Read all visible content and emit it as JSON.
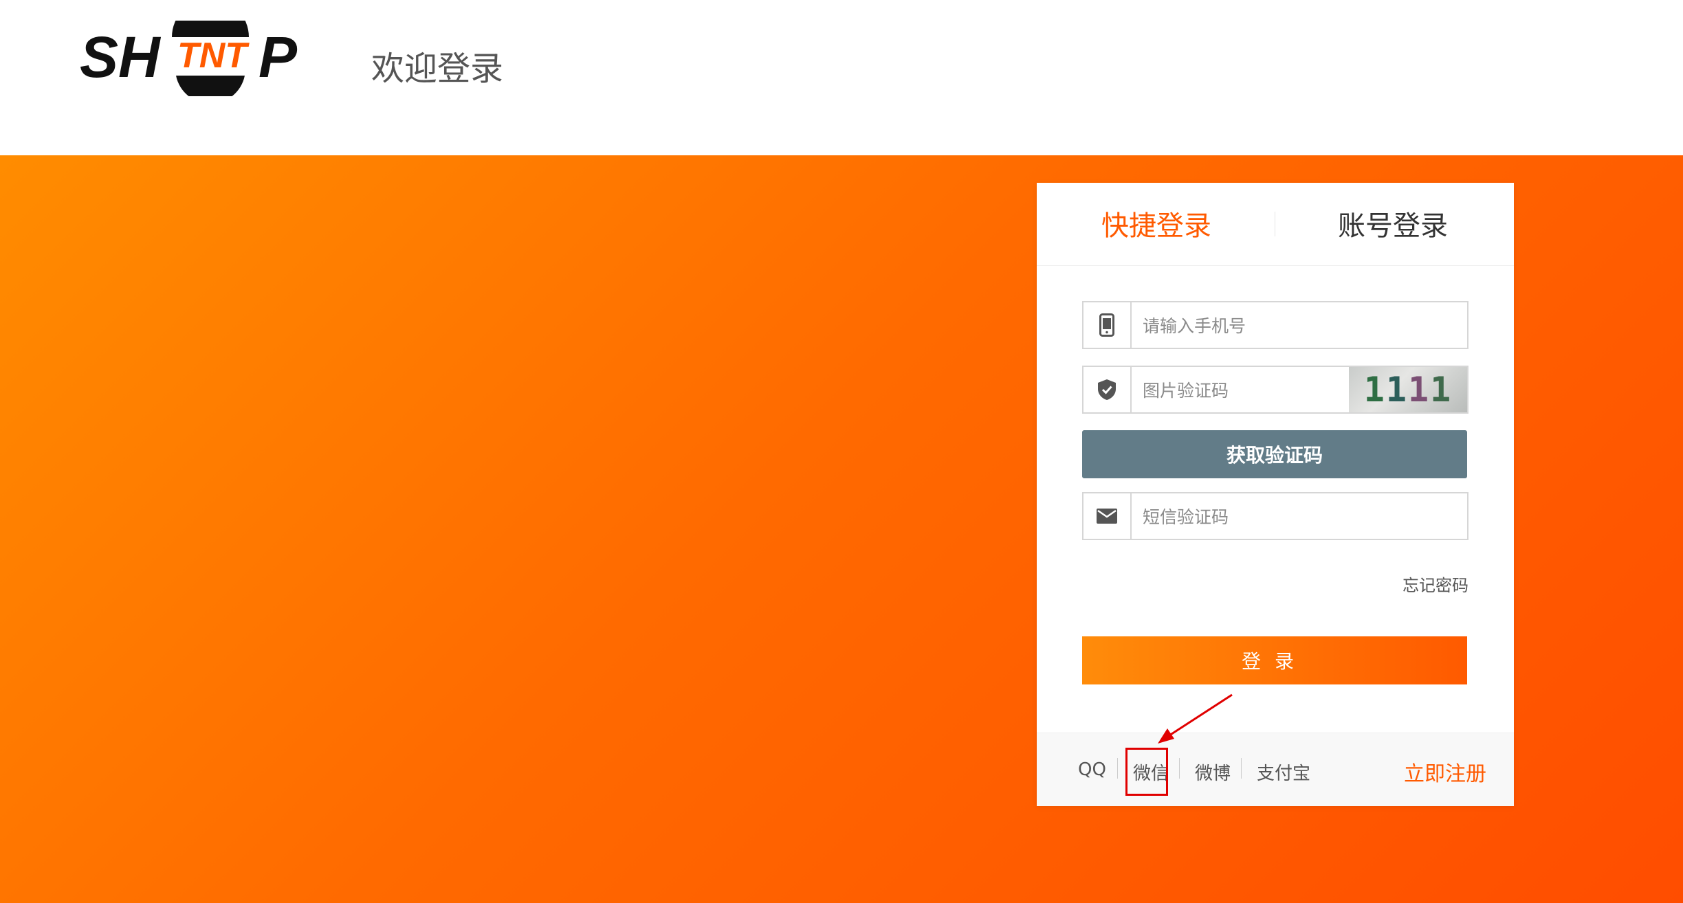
{
  "header": {
    "logo": {
      "left_text": "SH",
      "center_text": "TNT",
      "right_text": "P",
      "colors": {
        "dark": "#111111",
        "accent": "#ff5a00"
      }
    },
    "welcome": "欢迎登录"
  },
  "login_card": {
    "tabs": [
      {
        "label": "快捷登录",
        "active": true
      },
      {
        "label": "账号登录",
        "active": false
      }
    ],
    "phone_field": {
      "icon": "mobile-phone-icon",
      "placeholder": "请输入手机号",
      "value": ""
    },
    "captcha_field": {
      "icon": "shield-check-icon",
      "placeholder": "图片验证码",
      "value": "",
      "captcha_text": "1111"
    },
    "get_code_button": "获取验证码",
    "sms_field": {
      "icon": "envelope-icon",
      "placeholder": "短信验证码",
      "value": ""
    },
    "forgot_password": "忘记密码",
    "login_button": "登录",
    "social_logins": [
      "QQ",
      "微信",
      "微博",
      "支付宝"
    ],
    "register": "立即注册"
  },
  "colors": {
    "accent": "#ff5a00",
    "hero_gradient_start": "#ff8c00",
    "hero_gradient_end": "#ff4d00",
    "get_code_button": "#627c88",
    "annotation": "#e00000"
  },
  "annotation": {
    "target": "微信"
  }
}
